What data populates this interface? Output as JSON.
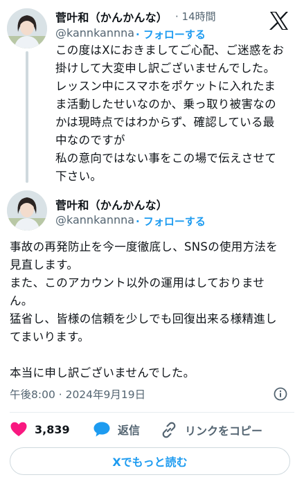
{
  "tweet1": {
    "display_name": "菅叶和（かんかんな）",
    "separator_time": "· 14時間",
    "handle": "@kannkannna",
    "follow_label": "· フォローする",
    "text": "この度はXにおきましてご心配、ご迷惑をお\n掛けして大変申し訳ございませんでした。\nレッスン中にスマホをポケットに入れたま\nま活動したせいなのか、乗っ取り被害なの\nかは現時点ではわからず、確認している最\n中なのですが\n私の意向ではない事をこの場で伝えさせて\n下さい。"
  },
  "tweet2": {
    "display_name": "菅叶和（かんかんな）",
    "handle": "@kannkannna",
    "follow_label": "· フォローする",
    "text": "事故の再発防止を今一度徹底し、SNSの使用方法を\n見直します。\nまた、このアカウント以外の運用はしておりませ\nん。\n猛省し、皆様の信頼を少しでも回復出来る様精進し\nてまいります。\n\n本当に申し訳ございませんでした。",
    "timestamp": "午後8:00 · 2024年9月19日"
  },
  "actions": {
    "like_count": "3,839",
    "reply_label": "返信",
    "copy_link_label": "リンクをコピー"
  },
  "read_more_label": "Xでもっと読む",
  "icons": {
    "brand": "x-logo-icon",
    "like": "heart-icon",
    "reply": "speech-bubble-icon",
    "copy_link": "link-icon",
    "info": "info-icon"
  },
  "colors": {
    "accent": "#1d9bf0",
    "like": "#f91880",
    "muted": "#536471",
    "text": "#0f1419"
  }
}
